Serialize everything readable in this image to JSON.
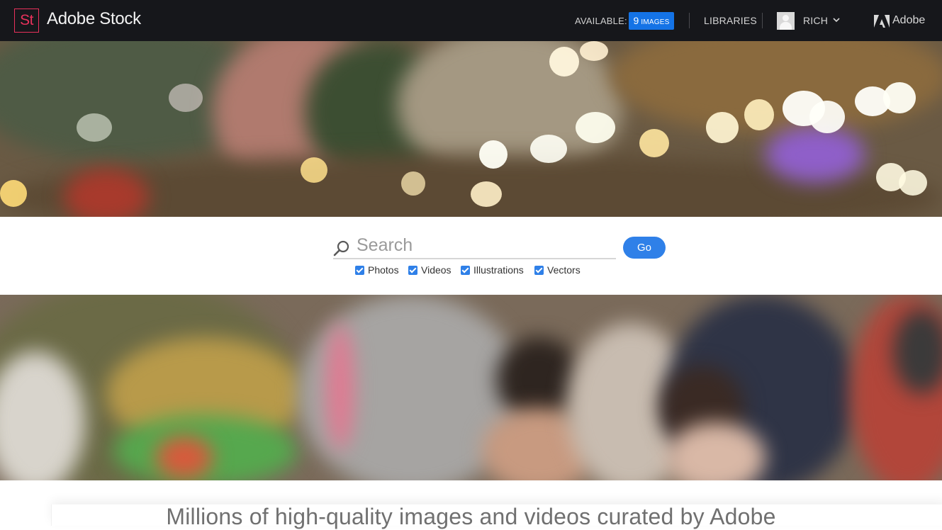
{
  "header": {
    "logo_text": "St",
    "brand": "Adobe Stock",
    "available_label": "AVAILABLE:",
    "available_count": "9",
    "available_unit": "IMAGES",
    "libraries_label": "LIBRARIES",
    "username": "RICH",
    "adobe_label": "Adobe"
  },
  "search": {
    "placeholder": "Search",
    "value": "",
    "go_label": "Go",
    "filters": [
      {
        "label": "Photos",
        "checked": true
      },
      {
        "label": "Videos",
        "checked": true
      },
      {
        "label": "Illustrations",
        "checked": true
      },
      {
        "label": "Vectors",
        "checked": true
      }
    ]
  },
  "main": {
    "headline": "Millions of high-quality images and videos curated by Adobe"
  },
  "colors": {
    "topbar_bg": "#16171b",
    "brand_accent": "#e8315b",
    "primary_blue": "#1473e6",
    "go_button": "#2f80e8"
  },
  "icons": {
    "search": "search-icon",
    "chevron": "chevron-down-icon",
    "adobe": "adobe-logo-icon",
    "avatar": "user-avatar-icon"
  }
}
